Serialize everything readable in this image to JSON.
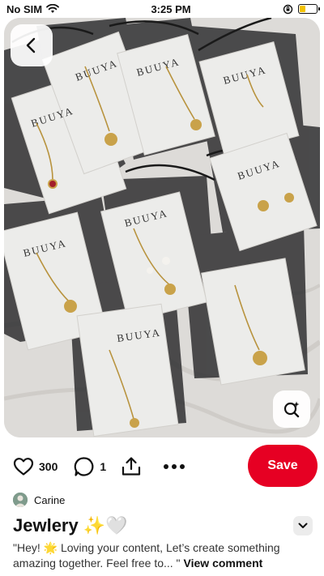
{
  "status": {
    "carrier": "No SIM",
    "time": "3:25 PM",
    "battery_level": 0.35,
    "battery_color": "#f2c200"
  },
  "image": {
    "description_icons": [
      "back-icon",
      "visual-search-icon"
    ],
    "brand_text": "BUUYA"
  },
  "actions": {
    "like_count": "300",
    "comment_count": "1",
    "save_label": "Save",
    "save_color": "#e60023"
  },
  "author": {
    "name": "Carine"
  },
  "pin": {
    "title": "Jewlery ✨🤍",
    "comment_text": "\"Hey! 🌟 Loving your content, Let’s create something amazing together. Feel free to... \"",
    "view_comment_label": "View comment"
  }
}
